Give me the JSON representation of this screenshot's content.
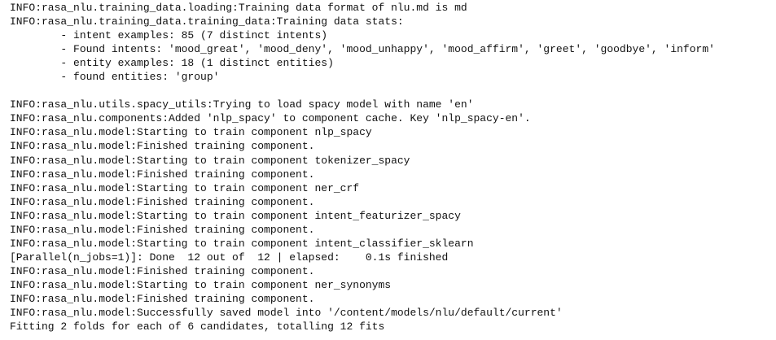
{
  "console": {
    "lines": [
      "INFO:rasa_nlu.training_data.loading:Training data format of nlu.md is md",
      "INFO:rasa_nlu.training_data.training_data:Training data stats:",
      "        - intent examples: 85 (7 distinct intents)",
      "        - Found intents: 'mood_great', 'mood_deny', 'mood_unhappy', 'mood_affirm', 'greet', 'goodbye', 'inform'",
      "        - entity examples: 18 (1 distinct entities)",
      "        - found entities: 'group'",
      "",
      "INFO:rasa_nlu.utils.spacy_utils:Trying to load spacy model with name 'en'",
      "INFO:rasa_nlu.components:Added 'nlp_spacy' to component cache. Key 'nlp_spacy-en'.",
      "INFO:rasa_nlu.model:Starting to train component nlp_spacy",
      "INFO:rasa_nlu.model:Finished training component.",
      "INFO:rasa_nlu.model:Starting to train component tokenizer_spacy",
      "INFO:rasa_nlu.model:Finished training component.",
      "INFO:rasa_nlu.model:Starting to train component ner_crf",
      "INFO:rasa_nlu.model:Finished training component.",
      "INFO:rasa_nlu.model:Starting to train component intent_featurizer_spacy",
      "INFO:rasa_nlu.model:Finished training component.",
      "INFO:rasa_nlu.model:Starting to train component intent_classifier_sklearn",
      "[Parallel(n_jobs=1)]: Done  12 out of  12 | elapsed:    0.1s finished",
      "INFO:rasa_nlu.model:Finished training component.",
      "INFO:rasa_nlu.model:Starting to train component ner_synonyms",
      "INFO:rasa_nlu.model:Finished training component.",
      "INFO:rasa_nlu.model:Successfully saved model into '/content/models/nlu/default/current'",
      "Fitting 2 folds for each of 6 candidates, totalling 12 fits"
    ]
  }
}
